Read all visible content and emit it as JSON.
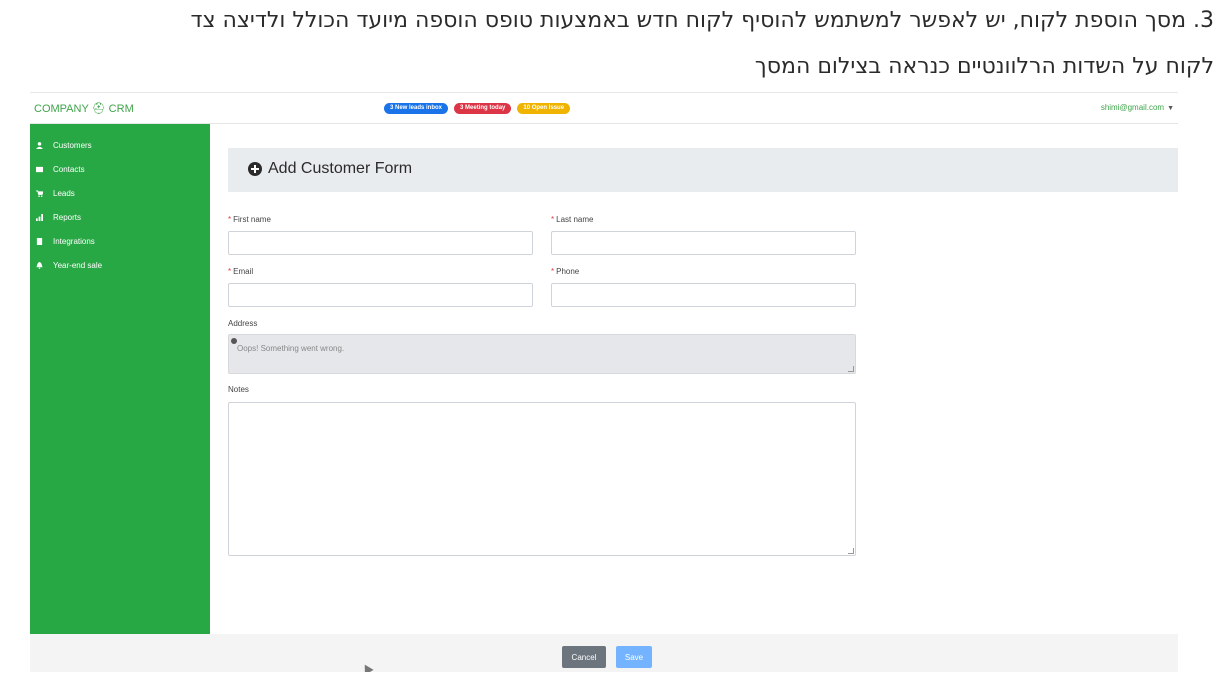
{
  "doc": {
    "line1": "3. מסך הוספת לקוח, יש לאפשר למשתמש להוסיף לקוח חדש באמצעות טופס הוספה מיועד הכולל ולדיצה צד",
    "line2": "לקוח על השדות הרלוונטיים כנראה בצילום המסך"
  },
  "topbar": {
    "brand": "COMPANY ⛑ CRM",
    "badges": [
      {
        "label": "3 New leads inbox",
        "color": "#1a73e8"
      },
      {
        "label": "3 Meeting today",
        "color": "#dc3545"
      },
      {
        "label": "10 Open Issue",
        "color": "#f0b400"
      }
    ],
    "user_email": "shimi@gmail.com",
    "user_caret": "▼"
  },
  "sidebar": {
    "items": [
      {
        "label": "Customers",
        "icon": "user-icon"
      },
      {
        "label": "Contacts",
        "icon": "address-card-icon"
      },
      {
        "label": "Leads",
        "icon": "cart-icon"
      },
      {
        "label": "Reports",
        "icon": "chart-icon"
      },
      {
        "label": "Integrations",
        "icon": "plug-icon"
      },
      {
        "label": "Year-end sale",
        "icon": "bell-icon"
      }
    ]
  },
  "form": {
    "title": "Add Customer Form",
    "first_name_label": "First name",
    "last_name_label": "Last name",
    "email_label": "Email",
    "phone_label": "Phone",
    "address_label": "Address",
    "address_error": "Oops! Something went wrong.",
    "notes_label": "Notes",
    "required_mark": "*"
  },
  "footer": {
    "cancel_label": "Cancel",
    "save_label": "Save"
  }
}
